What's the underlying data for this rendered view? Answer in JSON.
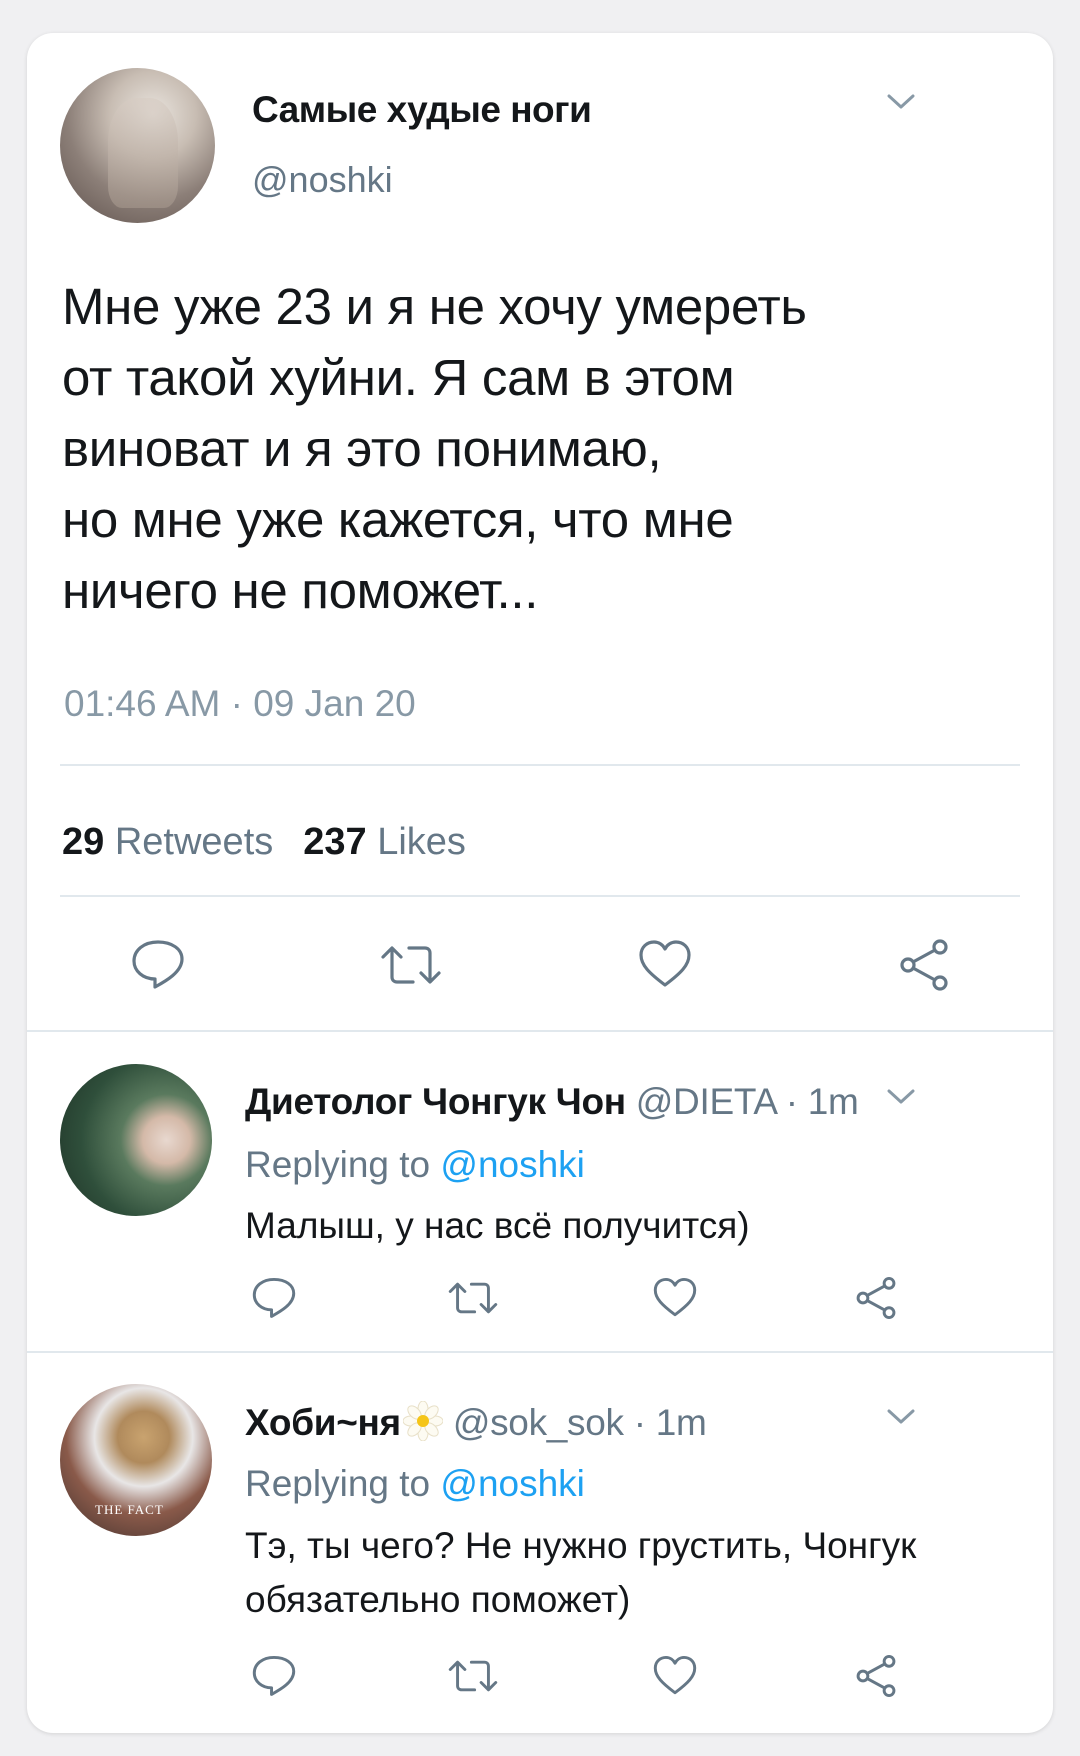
{
  "main_tweet": {
    "display_name": "Самые худые ноги",
    "handle": "@noshki",
    "text": "Мне уже 23 и я не хочу умереть\nот такой хуйни. Я сам в этом\nвиноват и я это понимаю,\nно мне уже кажется, что мне\nничего не поможет...",
    "timestamp": "01:46 AM · 09 Jan 20",
    "retweets_count": "29",
    "retweets_label": "Retweets",
    "likes_count": "237",
    "likes_label": "Likes"
  },
  "replies": [
    {
      "display_name": "Диетолог Чонгук Чон",
      "meta": "@DIETA · 1m",
      "replying_prefix": "Replying to ",
      "replying_mention": "@noshki",
      "text": "Малыш, у нас всё получится)"
    },
    {
      "display_name": "Хоби~ня",
      "meta": "@sok_sok · 1m",
      "replying_prefix": "Replying to ",
      "replying_mention": "@noshki",
      "text": "Тэ, ты чего? Не нужно грустить, Чонгук обязательно поможет)",
      "avatar_watermark": "THE FACT"
    }
  ],
  "icons": {
    "reply": "reply-icon",
    "retweet": "retweet-icon",
    "like": "heart-icon",
    "share": "share-icon",
    "more": "chevron-down-icon"
  },
  "colors": {
    "link": "#1da1f2",
    "secondary_text": "#657786",
    "icon_gray": "#657786",
    "divider": "#e1e8ed"
  }
}
